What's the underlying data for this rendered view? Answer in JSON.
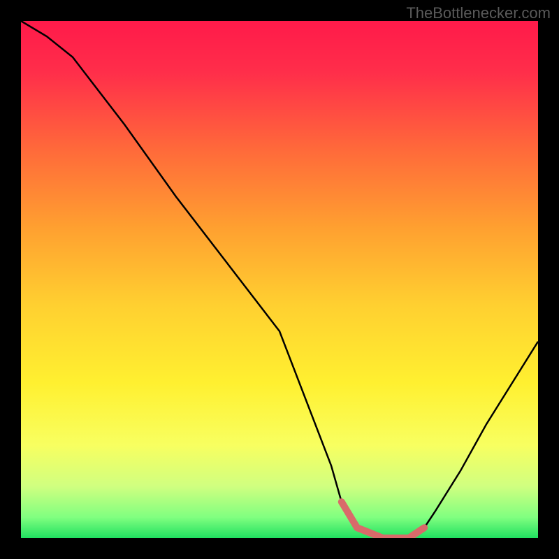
{
  "watermark": "TheBottlenecker.com",
  "chart_data": {
    "type": "line",
    "title": "",
    "xlabel": "",
    "ylabel": "",
    "xlim": [
      0,
      100
    ],
    "ylim": [
      0,
      100
    ],
    "series": [
      {
        "name": "curve",
        "x": [
          0,
          5,
          10,
          20,
          30,
          40,
          50,
          60,
          62,
          65,
          70,
          75,
          78,
          80,
          85,
          90,
          95,
          100
        ],
        "y": [
          100,
          97,
          93,
          80,
          66,
          53,
          40,
          14,
          7,
          2,
          0,
          0,
          2,
          5,
          13,
          22,
          30,
          38
        ]
      }
    ],
    "annotations": [
      {
        "name": "bottom-highlight",
        "type": "segment",
        "x": [
          62,
          65,
          70,
          75,
          78
        ],
        "y": [
          7,
          2,
          0,
          0,
          2
        ],
        "color": "#d96a6a"
      }
    ],
    "gradient_stops": [
      {
        "offset": 0.0,
        "color": "#ff1a4a"
      },
      {
        "offset": 0.1,
        "color": "#ff2e4a"
      },
      {
        "offset": 0.25,
        "color": "#ff6a3a"
      },
      {
        "offset": 0.4,
        "color": "#ffa030"
      },
      {
        "offset": 0.55,
        "color": "#ffd030"
      },
      {
        "offset": 0.7,
        "color": "#fff030"
      },
      {
        "offset": 0.82,
        "color": "#f8ff60"
      },
      {
        "offset": 0.9,
        "color": "#d0ff80"
      },
      {
        "offset": 0.96,
        "color": "#80ff80"
      },
      {
        "offset": 1.0,
        "color": "#20e060"
      }
    ]
  }
}
